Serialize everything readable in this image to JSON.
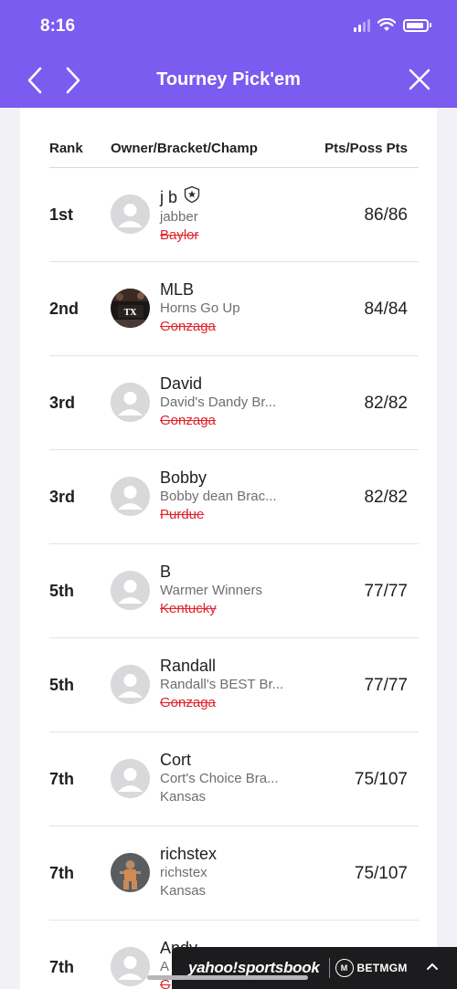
{
  "status_bar": {
    "time": "8:16"
  },
  "nav": {
    "title": "Tourney Pick'em"
  },
  "table": {
    "headers": {
      "rank": "Rank",
      "owner": "Owner/Bracket/Champ",
      "points": "Pts/Poss Pts"
    },
    "rows": [
      {
        "rank": "1st",
        "owner": "j b",
        "bracket": "jabber",
        "champ": "Baylor",
        "champ_eliminated": true,
        "points": "86/86",
        "avatar": "default",
        "badge": "shield-star-icon"
      },
      {
        "rank": "2nd",
        "owner": "MLB",
        "bracket": "Horns Go Up",
        "champ": "Gonzaga",
        "champ_eliminated": true,
        "points": "84/84",
        "avatar": "texas-photo"
      },
      {
        "rank": "3rd",
        "owner": "David",
        "bracket": "David's Dandy Br...",
        "champ": "Gonzaga",
        "champ_eliminated": true,
        "points": "82/82",
        "avatar": "default"
      },
      {
        "rank": "3rd",
        "owner": "Bobby",
        "bracket": "Bobby dean Brac...",
        "champ": "Purdue",
        "champ_eliminated": true,
        "points": "82/82",
        "avatar": "default"
      },
      {
        "rank": "5th",
        "owner": "B",
        "bracket": "Warmer Winners",
        "champ": "Kentucky",
        "champ_eliminated": true,
        "points": "77/77",
        "avatar": "default"
      },
      {
        "rank": "5th",
        "owner": "Randall",
        "bracket": "Randall's BEST Br...",
        "champ": "Gonzaga",
        "champ_eliminated": true,
        "points": "77/77",
        "avatar": "default"
      },
      {
        "rank": "7th",
        "owner": "Cort",
        "bracket": "Cort's Choice Bra...",
        "champ": "Kansas",
        "champ_eliminated": false,
        "points": "75/107",
        "avatar": "default"
      },
      {
        "rank": "7th",
        "owner": "richstex",
        "bracket": "richstex",
        "champ": "Kansas",
        "champ_eliminated": false,
        "points": "75/107",
        "avatar": "person-photo"
      },
      {
        "rank": "7th",
        "owner": "Andy",
        "bracket": "A",
        "champ": "G",
        "champ_eliminated": true,
        "points": "",
        "avatar": "default"
      }
    ]
  },
  "sportsbook": {
    "brand": "yahoo!sportsbook",
    "partner_badge": "M",
    "partner": "BETMGM"
  },
  "colors": {
    "accent": "#7b5bf0",
    "eliminated": "#e0222c",
    "banner_bg": "#1c1c1e"
  }
}
